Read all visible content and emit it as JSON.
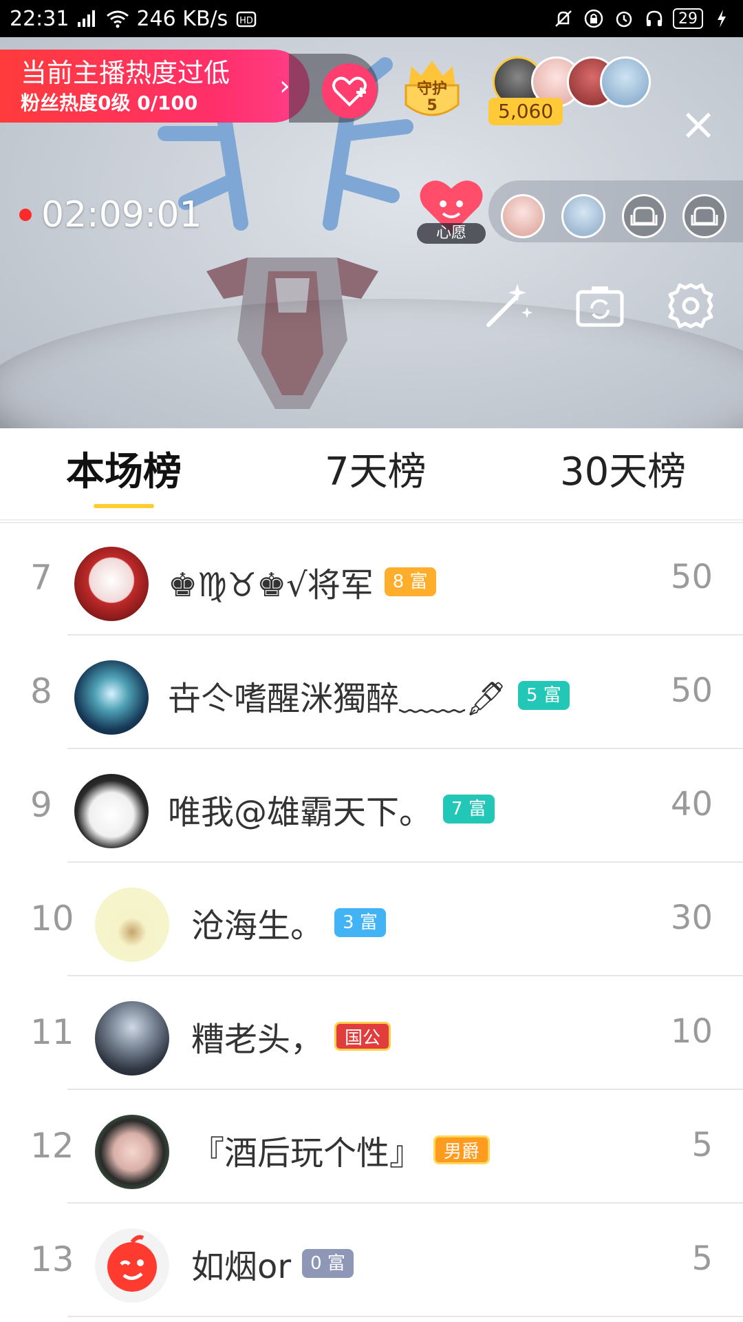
{
  "status_bar": {
    "time": "22:31",
    "network_speed": "246 KB/s",
    "battery": "29"
  },
  "live": {
    "heat_banner": {
      "title": "当前主播热度过低",
      "subtitle": "粉丝热度0级 0/100",
      "arrow": "›"
    },
    "guard": {
      "label": "守护",
      "count": "5"
    },
    "viewer_count": "5,060",
    "timer": "02:09:01",
    "wish_label": "心愿",
    "close": "×",
    "colors": {
      "rec_dot": "#ff2a2a",
      "banner_start": "#ff3b3b",
      "banner_end": "#ff3f8a",
      "follow": "#ff3d6e",
      "viewer_badge": "#ffc938"
    }
  },
  "tabs": [
    {
      "label": "本场榜",
      "active": true
    },
    {
      "label": "7天榜",
      "active": false
    },
    {
      "label": "30天榜",
      "active": false
    }
  ],
  "list": [
    {
      "rank": "7",
      "name": "♚♍♉♚√将军",
      "badge": "8 富",
      "badge_color": "#ffae2b",
      "score": "50",
      "avatar_icon": "red-seal-avatar"
    },
    {
      "rank": "8",
      "name": "卋仒嗜醒洣獨醉﹏﹏🖋",
      "badge": "5 富",
      "badge_color": "#22c7b8",
      "score": "50",
      "avatar_icon": "skull-avatar"
    },
    {
      "rank": "9",
      "name": "唯我@雄霸天下。",
      "badge": "7 富",
      "badge_color": "#22c7b8",
      "score": "40",
      "avatar_icon": "husky-avatar"
    },
    {
      "rank": "10",
      "name": "沧海生。",
      "badge": "3 富",
      "badge_color": "#42b4f5",
      "score": "30",
      "avatar_icon": "snail-avatar"
    },
    {
      "rank": "11",
      "name": "糟老头，",
      "badge": "国公",
      "badge_color": "#e23d3d",
      "score": "10",
      "avatar_icon": "monk-avatar"
    },
    {
      "rank": "12",
      "name": "『酒后玩个性』",
      "badge": "男爵",
      "badge_color": "#ff9c1f",
      "score": "5",
      "avatar_icon": "girl-avatar"
    },
    {
      "rank": "13",
      "name": "如烟or",
      "badge": "0 富",
      "badge_color": "#8e97b5",
      "score": "5",
      "avatar_icon": "wink-avatar"
    }
  ]
}
